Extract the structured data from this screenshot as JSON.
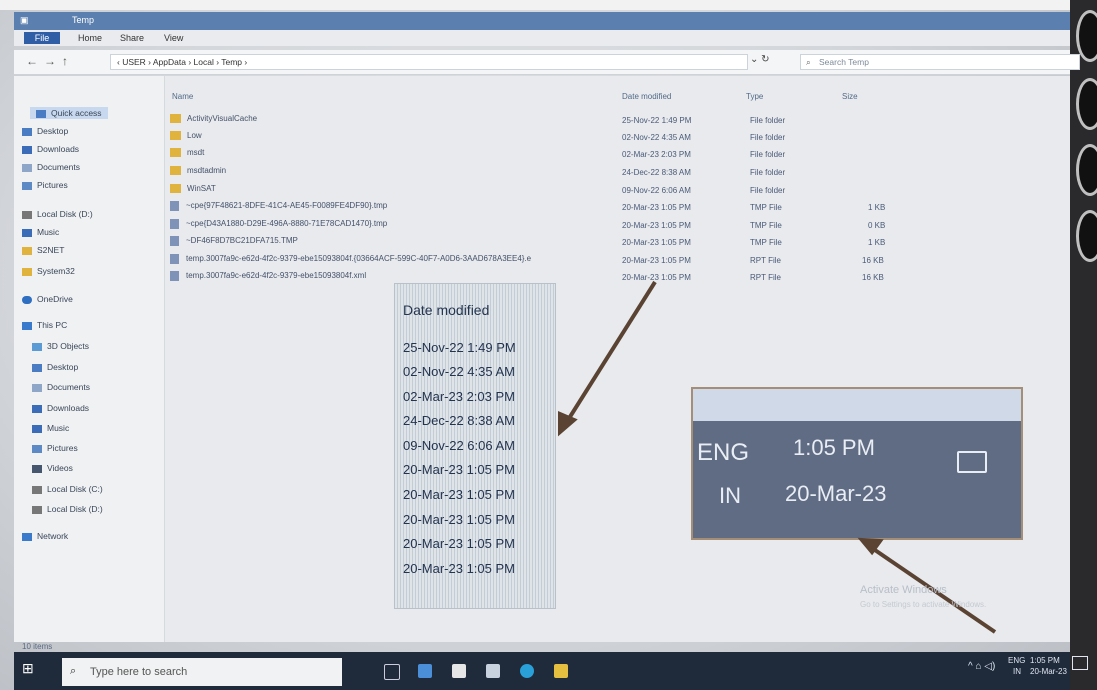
{
  "window": {
    "title": "Temp",
    "ribbon_tabs": [
      "File",
      "Home",
      "Share",
      "View"
    ]
  },
  "address": {
    "path": "‹ USER › AppData › Local › Temp ›",
    "search_placeholder": "Search Temp"
  },
  "nav": {
    "quick_access": "Quick access",
    "pinned": [
      "Desktop",
      "Downloads",
      "Documents",
      "Pictures",
      "Local Disk (D:)",
      "Music",
      "S2NET",
      "System32"
    ],
    "onedrive": "OneDrive",
    "this_pc": "This PC",
    "pc_items": [
      "3D Objects",
      "Desktop",
      "Documents",
      "Downloads",
      "Music",
      "Pictures",
      "Videos",
      "Local Disk (C:)",
      "Local Disk (D:)"
    ],
    "network": "Network"
  },
  "columns": {
    "name": "Name",
    "date": "Date modified",
    "type": "Type",
    "size": "Size"
  },
  "files": [
    {
      "name": "ActivityVisualCache",
      "date": "25-Nov-22 1:49 PM",
      "type": "File folder",
      "size": ""
    },
    {
      "name": "Low",
      "date": "02-Nov-22 4:35 AM",
      "type": "File folder",
      "size": ""
    },
    {
      "name": "msdt",
      "date": "02-Mar-23 2:03 PM",
      "type": "File folder",
      "size": ""
    },
    {
      "name": "msdtadmin",
      "date": "24-Dec-22 8:38 AM",
      "type": "File folder",
      "size": ""
    },
    {
      "name": "WinSAT",
      "date": "09-Nov-22 6:06 AM",
      "type": "File folder",
      "size": ""
    },
    {
      "name": "~cpe{97F48621-8DFE-41C4-AE45-F0089FE4DF90}.tmp",
      "date": "20-Mar-23 1:05 PM",
      "type": "TMP File",
      "size": "1 KB"
    },
    {
      "name": "~cpe{D43A1880-D29E-496A-8880-71E78CAD1470}.tmp",
      "date": "20-Mar-23 1:05 PM",
      "type": "TMP File",
      "size": "0 KB"
    },
    {
      "name": "~DF46F8D7BC21DFA715.TMP",
      "date": "20-Mar-23 1:05 PM",
      "type": "TMP File",
      "size": "1 KB"
    },
    {
      "name": "temp.3007fa9c-e62d-4f2c-9379-ebe15093804f.{03664ACF-599C-40F7-A0D6-3AAD678A3EE4}.e",
      "date": "20-Mar-23 1:05 PM",
      "type": "RPT File",
      "size": "16 KB"
    },
    {
      "name": "temp.3007fa9c-e62d-4f2c-9379-ebe15093804f.xml",
      "date": "20-Mar-23 1:05 PM",
      "type": "RPT File",
      "size": "16 KB"
    }
  ],
  "status": "10 items",
  "zoom_dates": {
    "title": "Date modified",
    "values": [
      "25-Nov-22 1:49 PM",
      "02-Nov-22 4:35 AM",
      "02-Mar-23 2:03 PM",
      "24-Dec-22 8:38 AM",
      "09-Nov-22 6:06 AM",
      "20-Mar-23 1:05 PM",
      "20-Mar-23 1:05 PM",
      "20-Mar-23 1:05 PM",
      "20-Mar-23 1:05 PM",
      "20-Mar-23 1:05 PM"
    ]
  },
  "zoom_clock": {
    "lang1": "ENG",
    "lang2": "IN",
    "time": "1:05 PM",
    "date": "20-Mar-23"
  },
  "activate": {
    "title": "Activate Windows",
    "sub": "Go to Settings to activate Windows."
  },
  "taskbar": {
    "search_placeholder": "Type here to search",
    "lang1": "ENG",
    "lang2": "IN",
    "time": "1:05 PM",
    "date": "20-Mar-23"
  }
}
